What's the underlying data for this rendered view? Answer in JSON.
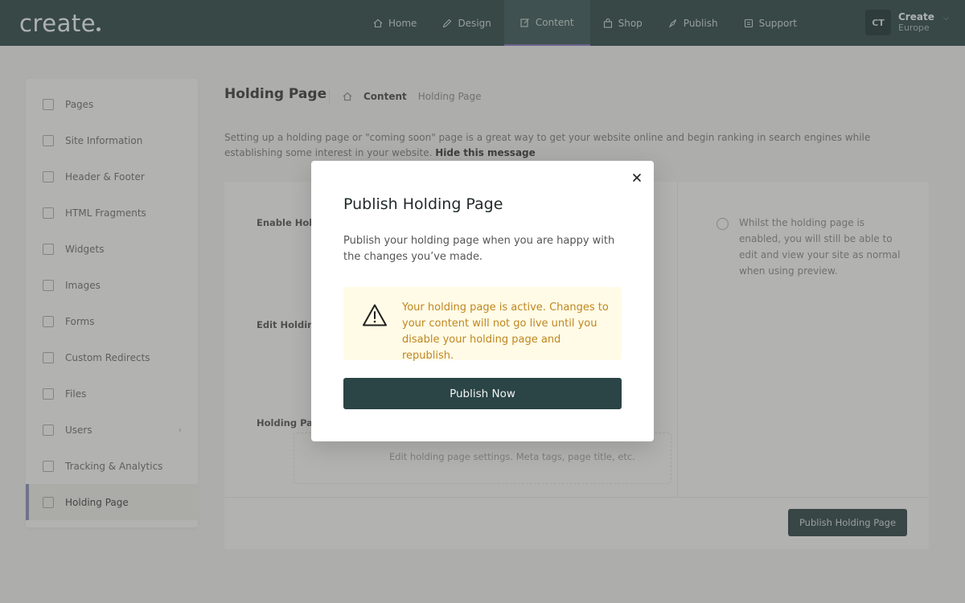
{
  "app": {
    "logo": "create"
  },
  "nav": {
    "items": [
      {
        "label": "Home",
        "icon": "home-icon"
      },
      {
        "label": "Design",
        "icon": "pen-icon"
      },
      {
        "label": "Content",
        "icon": "edit-icon",
        "active": true
      },
      {
        "label": "Shop",
        "icon": "bag-icon"
      },
      {
        "label": "Publish",
        "icon": "rocket-icon"
      },
      {
        "label": "Support",
        "icon": "support-icon"
      }
    ],
    "active_color": "#7f73b8"
  },
  "user": {
    "initials": "CT",
    "name": "Create",
    "subtitle": "Europe"
  },
  "sidebar": {
    "items": [
      {
        "label": "Pages",
        "icon": "pages-icon"
      },
      {
        "label": "Site Information",
        "icon": "info-card-icon"
      },
      {
        "label": "Header & Footer",
        "icon": "layout-icon"
      },
      {
        "label": "HTML Fragments",
        "icon": "code-icon"
      },
      {
        "label": "Widgets",
        "icon": "widget-icon"
      },
      {
        "label": "Images",
        "icon": "image-icon"
      },
      {
        "label": "Forms",
        "icon": "form-icon"
      },
      {
        "label": "Custom Redirects",
        "icon": "redirect-icon"
      },
      {
        "label": "Files",
        "icon": "folder-icon"
      },
      {
        "label": "Users",
        "icon": "users-icon",
        "has_submenu": true
      },
      {
        "label": "Tracking & Analytics",
        "icon": "chart-icon"
      },
      {
        "label": "Holding Page",
        "icon": "holding-page-icon",
        "active": true
      }
    ]
  },
  "main": {
    "title": "Holding Page",
    "breadcrumb": {
      "home_icon": "home-icon",
      "section": "Content",
      "current": "Holding Page"
    },
    "intro": "Setting up a holding page or \"coming soon\" page is a great way to get your website online and begin ranking in search engines while establishing some interest in your website.",
    "hide_message": "Hide this message",
    "fields": {
      "enable_label": "Enable Holdi",
      "edit_label": "Edit Holding",
      "page_label": "Holding Pag"
    },
    "info_text": "Whilst the holding page is enabled, you will still be able to edit and view your site as normal when using preview.",
    "edit_hint": "Edit holding page settings. Meta tags, page title, etc.",
    "publish_button": "Publish Holding Page"
  },
  "modal": {
    "title": "Publish Holding Page",
    "description": "Publish your holding page when you are happy with the changes you’ve made.",
    "alert_text": "Your holding page is active. Changes to your content will not go live until you disable your holding page and republish.",
    "alert_color": "#c0861f",
    "alert_bg": "#fffbe6",
    "primary_button": "Publish Now",
    "primary_color": "#2b4446"
  }
}
